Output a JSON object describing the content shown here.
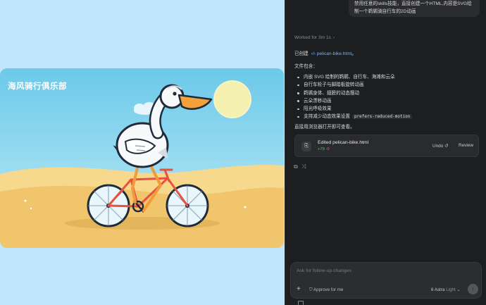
{
  "preview": {
    "card_title": "海风骑行俱乐部"
  },
  "chat": {
    "user_message_line1": "禁用任意的skills技能，直接创建一个HTML,内容是SVG绘",
    "user_message_line2": "制一个鹈鹕骑自行车的2D动画",
    "worked_for": "Worked for 3m 1s",
    "created_prefix": "已创建",
    "created_file": "pelican-bike.html",
    "created_suffix": "。",
    "file_contents_heading": "文件包含：",
    "features": [
      "内嵌 SVG 绘制的鹈鹕、自行车、海滩和云朵",
      "自行车轮子与脚踏板旋转动画",
      "鹈鹕身体、翅膀的动态摆动",
      "云朵漂移动画",
      "阳光呼吸效果",
      "支持减少动态效果设置"
    ],
    "reduced_motion_code": "prefers-reduced-motion",
    "open_hint": "直接用浏览器打开即可查看。",
    "edit_card": {
      "title": "Edited pelican-bike.html",
      "additions": "+79",
      "deletions": "-0",
      "undo_label": "Undo",
      "review_label": "Review"
    },
    "composer": {
      "placeholder": "Ask for follow-up changes",
      "approve_label": "Approve for me",
      "model_label": "6 Astra",
      "effort_label": "Light"
    }
  }
}
